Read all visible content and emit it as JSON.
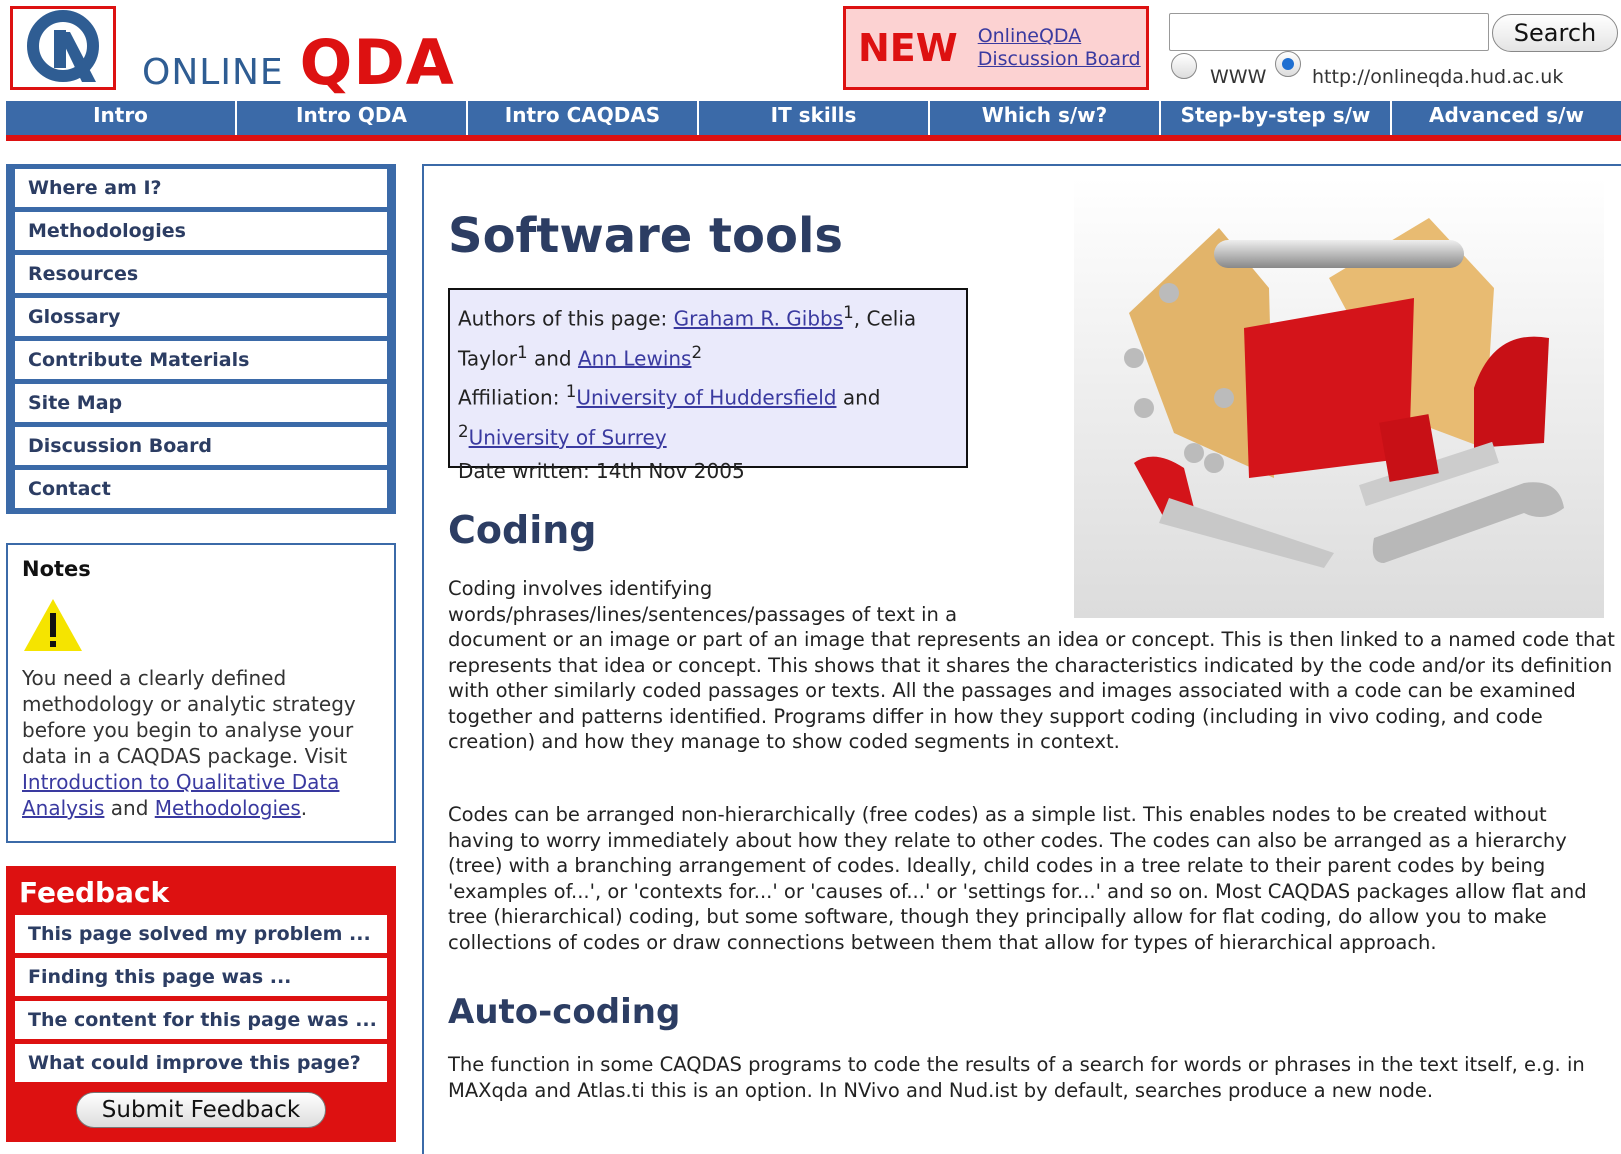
{
  "header": {
    "site_name_part1": "ONLINE",
    "site_name_part2": "QDA",
    "new_label": "NEW",
    "discussion_link_line1": "OnlineQDA",
    "discussion_link_line2": "Discussion Board",
    "search_button": "Search",
    "search_value": "",
    "radio_www": "WWW",
    "radio_site": "http://onlineqda.hud.ac.uk"
  },
  "nav": {
    "tabs": [
      "Intro",
      "Intro QDA",
      "Intro CAQDAS",
      "IT skills",
      "Which s/w?",
      "Step-by-step s/w",
      "Advanced s/w"
    ]
  },
  "sidebar": {
    "items": [
      "Where am I?",
      "Methodologies",
      "Resources",
      "Glossary",
      "Contribute Materials",
      "Site Map",
      "Discussion Board",
      "Contact"
    ]
  },
  "notes": {
    "title": "Notes",
    "text": "You need a clearly defined methodology or analytic strategy before you begin to analyse your data in a CAQDAS package. Visit ",
    "link1": "Introduction to Qualitative Data Analysis",
    "and": " and ",
    "link2": "Methodologies",
    "end": "."
  },
  "feedback": {
    "title": "Feedback",
    "items": [
      "This page solved my problem ...",
      "Finding this page was ...",
      "The content for this page was ...",
      "What could improve this page?"
    ],
    "submit": "Submit Feedback"
  },
  "main": {
    "title": "Software tools",
    "authors_label": "Authors of this page: ",
    "author1": "Graham R. Gibbs",
    "author1_sup": "1",
    "author2": ", Celia Taylor",
    "author2_sup": "1",
    "and_text": " and ",
    "author3": "Ann Lewins",
    "author3_sup": "2",
    "affiliation_label": "Affiliation: ",
    "aff1_sup": "1",
    "aff1": "University of Huddersfield",
    "aff_and": " and ",
    "aff2_sup": "2",
    "aff2": "University of Surrey",
    "date": "Date written: 14th Nov 2005",
    "coding_heading": "Coding",
    "coding_p1a": "Coding involves identifying words/phrases/lines/sentences/passages of text in a",
    "coding_p1b": "document or an image or part of an image that represents an idea or concept. This is then linked to a named code that represents that idea or concept. This shows that it shares the characteristics indicated by the code and/or its definition with other similarly coded passages or texts. All the passages and images associated with a code can be examined together and patterns identified. Programs differ in how they support coding (including in vivo coding, and code creation) and how they manage to show coded segments in context.",
    "coding_p2": "Codes can be arranged non-hierarchically (free codes) as a simple list. This enables nodes to be created without having to worry immediately about how they relate to other codes. The codes can also be arranged as a hierarchy (tree) with a branching arrangement of codes. Ideally, child codes in a tree relate to their parent codes by being 'examples of...', or 'contexts for...' or 'causes of...' or 'settings for...' and so on. Most CAQDAS packages allow flat and tree (hierarchical) coding, but some software, though they principally allow for flat coding, do allow you to make collections of codes or draw connections between them that allow for types of hierarchical approach.",
    "autocoding_heading": "Auto-coding",
    "autocoding_p": "The function in some CAQDAS programs to code the results of a search for words or phrases in the text itself, e.g. in MAXqda and Atlas.ti this is an option. In NVivo and Nud.ist by default, searches produce a new node."
  },
  "colors": {
    "brand_blue": "#3b6aa8",
    "brand_red": "#dd1111",
    "heading_navy": "#2c3d63"
  }
}
